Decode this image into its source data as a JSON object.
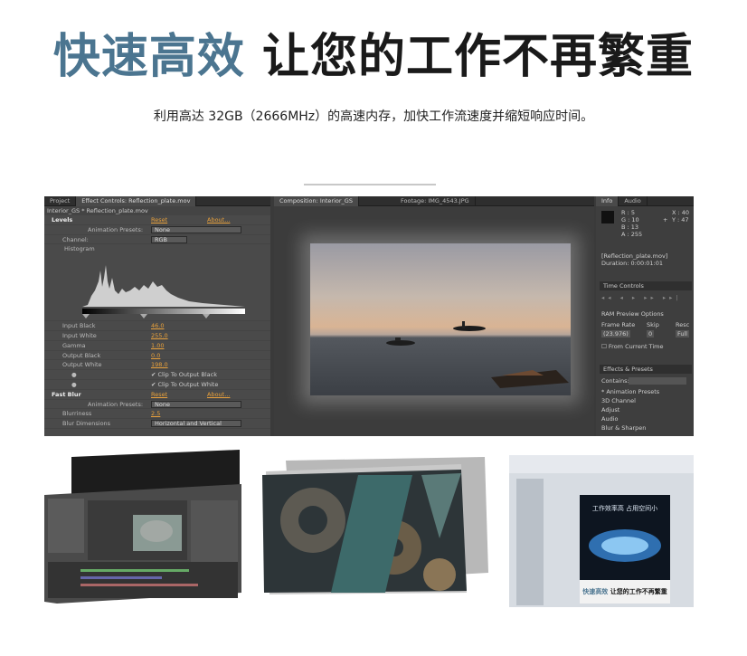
{
  "hero": {
    "title_accent": "快速高效",
    "title_main": "让您的工作不再繁重",
    "subtitle": "利用高达 32GB（2666MHz）的高速内存，加快工作流速度并缩短响应时间。"
  },
  "ae": {
    "left_tabs": [
      "Project",
      "Effect Controls: Reflection_plate.mov"
    ],
    "mid_tabs": [
      "Composition: Interior_GS",
      "Footage: IMG_4543.JPG"
    ],
    "right_tabs": [
      "Info",
      "Audio"
    ],
    "path": "Interior_GS * Reflection_plate.mov",
    "levels": {
      "name": "Levels",
      "reset": "Reset",
      "about": "About...",
      "preset_label": "Animation Presets:",
      "preset_value": "None",
      "channel_label": "Channel:",
      "channel_value": "RGB",
      "histogram_label": "Histogram",
      "params": [
        {
          "label": "Input Black",
          "value": "46.0"
        },
        {
          "label": "Input White",
          "value": "255.0"
        },
        {
          "label": "Gamma",
          "value": "1.00"
        },
        {
          "label": "Output Black",
          "value": "0.0"
        },
        {
          "label": "Output White",
          "value": "198.0"
        }
      ],
      "clip_black": "Clip To Output Black",
      "clip_white": "Clip To Output White"
    },
    "fast_blur": {
      "name": "Fast Blur",
      "reset": "Reset",
      "about": "About...",
      "preset_label": "Animation Presets:",
      "preset_value": "None",
      "blurriness_label": "Blurriness",
      "blurriness_value": "2.5",
      "dimensions_label": "Blur Dimensions",
      "dimensions_value": "Horizontal and Vertical"
    },
    "info": {
      "r": "R : 5",
      "g": "G : 10",
      "b": "B : 13",
      "a": "A : 255",
      "x": "X : 40",
      "y": "Y : 47",
      "clip": "[Reflection_plate.mov]",
      "duration": "Duration: 0:00:01:01"
    },
    "time_controls": "Time Controls",
    "ram_preview": "RAM Preview Options",
    "frame_rate_label": "Frame Rate",
    "frame_rate_value": "(23.976)",
    "skip_label": "Skip",
    "skip_value": "0",
    "res_label": "Resc",
    "res_value": "Full",
    "from_current": "From Current Time",
    "effects_presets": "Effects & Presets",
    "contains": "Contains:",
    "effect_items": [
      "* Animation Presets",
      "3D Channel",
      "Adjust",
      "Audio",
      "Blur & Sharpen"
    ]
  },
  "thumb3": {
    "poster_top": "工作效率高 占用空间小",
    "poster_accent": "快速高效",
    "poster_main": "让您的工作不再繁重"
  }
}
